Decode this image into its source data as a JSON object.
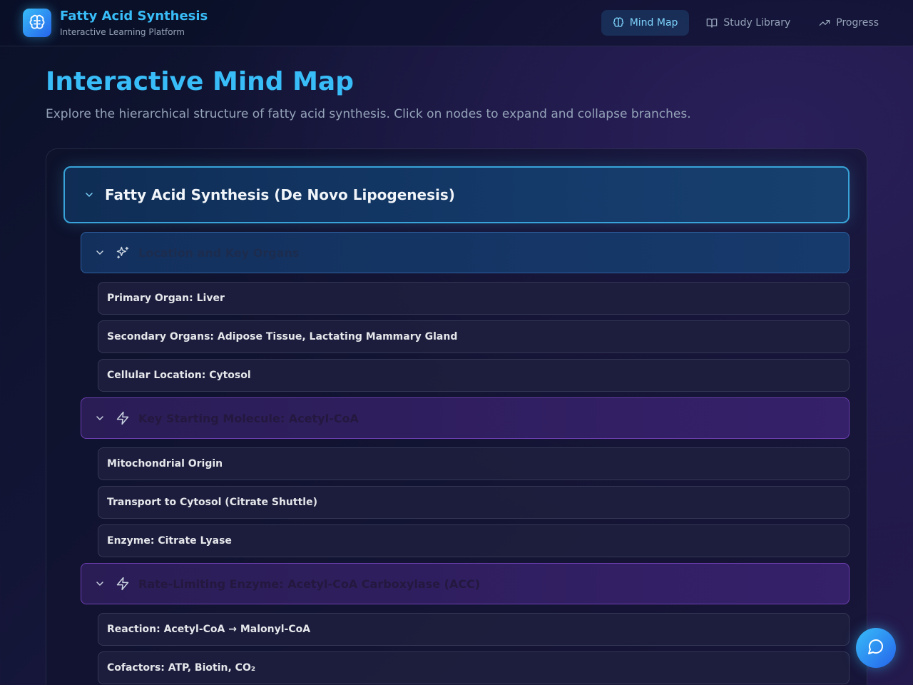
{
  "header": {
    "brand_title": "Fatty Acid Synthesis",
    "brand_subtitle": "Interactive Learning Platform",
    "nav": [
      {
        "label": "Mind Map",
        "icon": "brain-icon",
        "active": true
      },
      {
        "label": "Study Library",
        "icon": "book-icon",
        "active": false
      },
      {
        "label": "Progress",
        "icon": "trending-up-icon",
        "active": false
      }
    ]
  },
  "main": {
    "title": "Interactive Mind Map",
    "description": "Explore the hierarchical structure of fatty acid synthesis. Click on nodes to expand and collapse branches."
  },
  "mindmap": {
    "root": {
      "label": "Fatty Acid Synthesis (De Novo Lipogenesis)",
      "expanded": true
    },
    "branches": [
      {
        "label": "Location and Key Organs",
        "icon": "sparkles-icon",
        "color": "#163a6c",
        "expanded": true,
        "children": [
          "Primary Organ: Liver",
          "Secondary Organs: Adipose Tissue, Lactating Mammary Gland",
          "Cellular Location: Cytosol"
        ]
      },
      {
        "label": "Key Starting Molecule: Acetyl-CoA",
        "icon": "lightning-icon",
        "color": "#35206a",
        "expanded": true,
        "children": [
          "Mitochondrial Origin",
          "Transport to Cytosol (Citrate Shuttle)",
          "Enzyme: Citrate Lyase"
        ]
      },
      {
        "label": "Rate-Limiting Enzyme: Acetyl-CoA Carboxylase (ACC)",
        "icon": "lightning-icon",
        "color": "#35206a",
        "expanded": true,
        "children": [
          "Reaction: Acetyl-CoA → Malonyl-CoA",
          "Cofactors: ATP, Biotin, CO₂"
        ]
      }
    ]
  },
  "colors": {
    "accent": "#38bdf8",
    "root_border": "#38a3d8",
    "blue_branch_border": "#2f5f9e",
    "purple_branch_border": "#6d3fb0"
  },
  "chat_button": {
    "icon": "chat-bubble-icon"
  }
}
